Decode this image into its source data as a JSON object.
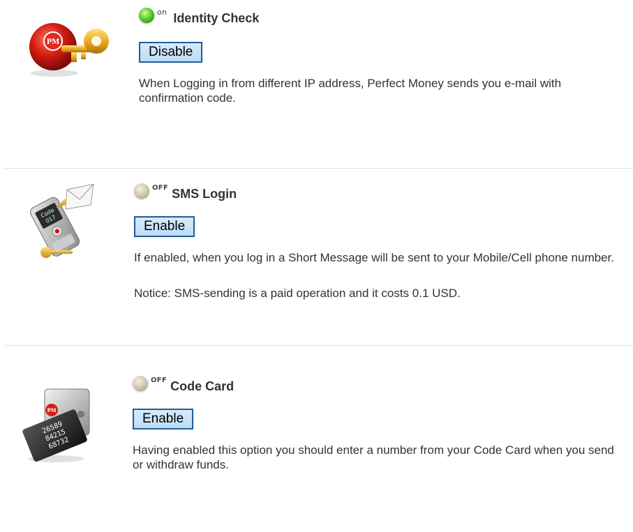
{
  "sections": [
    {
      "icon": "pm-key-icon",
      "status": "on",
      "title": "Identity Check",
      "button_label": "Disable",
      "description": "When Logging in from different IP address, Perfect Money sends you e-mail with confirmation code.",
      "notice": ""
    },
    {
      "icon": "sms-phone-icon",
      "status": "OFF",
      "title": "SMS Login",
      "button_label": "Enable",
      "description": "If enabled, when you log in a Short Message will be sent to your Mobile/Cell phone number.",
      "notice": "Notice: SMS-sending is a paid operation and it costs 0.1 USD."
    },
    {
      "icon": "code-card-icon",
      "status": "OFF",
      "title": "Code Card",
      "button_label": "Enable",
      "description": "Having enabled this option you should enter a number from your Code Card when you send or withdraw funds.",
      "notice": ""
    }
  ],
  "icon_labels": {
    "pm_badge": "PM",
    "phone_screen": [
      "Code",
      "017"
    ],
    "card_numbers": [
      "26589",
      "84215",
      "68732"
    ]
  },
  "colors": {
    "button_border": "#1f5c9a",
    "button_fill": "#c9e3f8",
    "led_on": "#3cc214",
    "led_off": "#c8bca4",
    "divider": "#e2e2e2"
  }
}
